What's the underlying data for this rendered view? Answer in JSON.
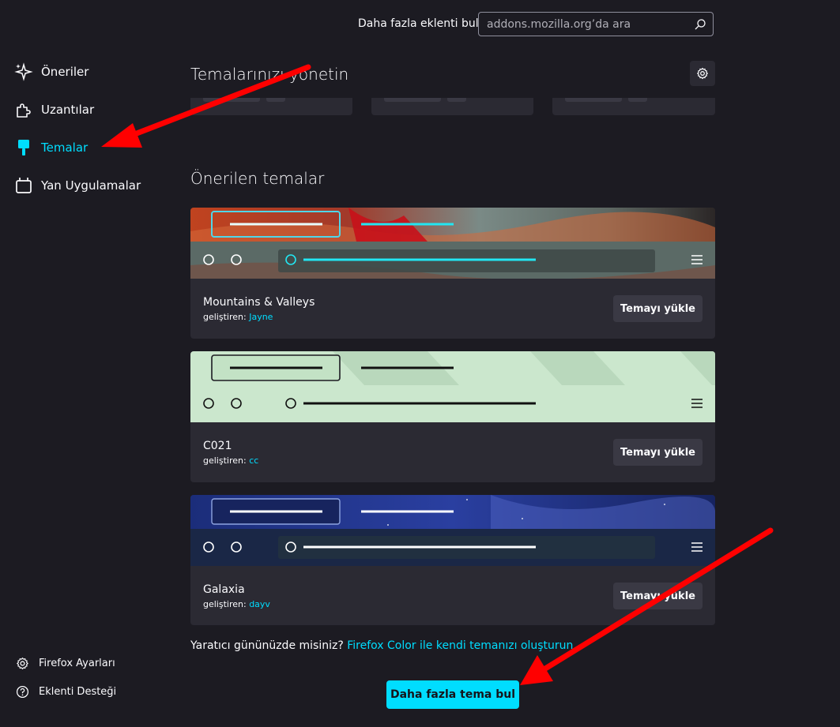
{
  "header": {
    "find_more_label": "Daha fazla eklenti bul",
    "search_placeholder": "addons.mozilla.org’da ara"
  },
  "sidebar": {
    "items": [
      {
        "label": "Öneriler",
        "icon": "sparkle-icon"
      },
      {
        "label": "Uzantılar",
        "icon": "puzzle-icon"
      },
      {
        "label": "Temalar",
        "icon": "brush-icon",
        "active": true
      },
      {
        "label": "Yan Uygulamalar",
        "icon": "plugin-icon"
      }
    ],
    "footer": [
      {
        "label": "Firefox Ayarları",
        "icon": "gear-icon"
      },
      {
        "label": "Eklenti Desteği",
        "icon": "help-icon"
      }
    ]
  },
  "main": {
    "title": "Temalarınızı yönetin",
    "recommended_title": "Önerilen temalar",
    "themes": [
      {
        "name": "Mountains & Valleys",
        "by_label": "geliştiren:",
        "author": "Jayne",
        "button": "Temayı yükle"
      },
      {
        "name": "C021",
        "by_label": "geliştiren:",
        "author": "cc",
        "button": "Temayı yükle"
      },
      {
        "name": "Galaxia",
        "by_label": "geliştiren:",
        "author": "dayv",
        "button": "Temayı yükle"
      }
    ],
    "footer_prompt": "Yaratıcı gününüzde misiniz?",
    "footer_link": "Firefox Color ile kendi temanızı oluşturun.",
    "more_themes_button": "Daha fazla tema bul"
  },
  "colors": {
    "accent": "#00ddff",
    "background": "#1c1b22",
    "card": "#2b2a33",
    "annotation_arrow": "#ff0000"
  }
}
